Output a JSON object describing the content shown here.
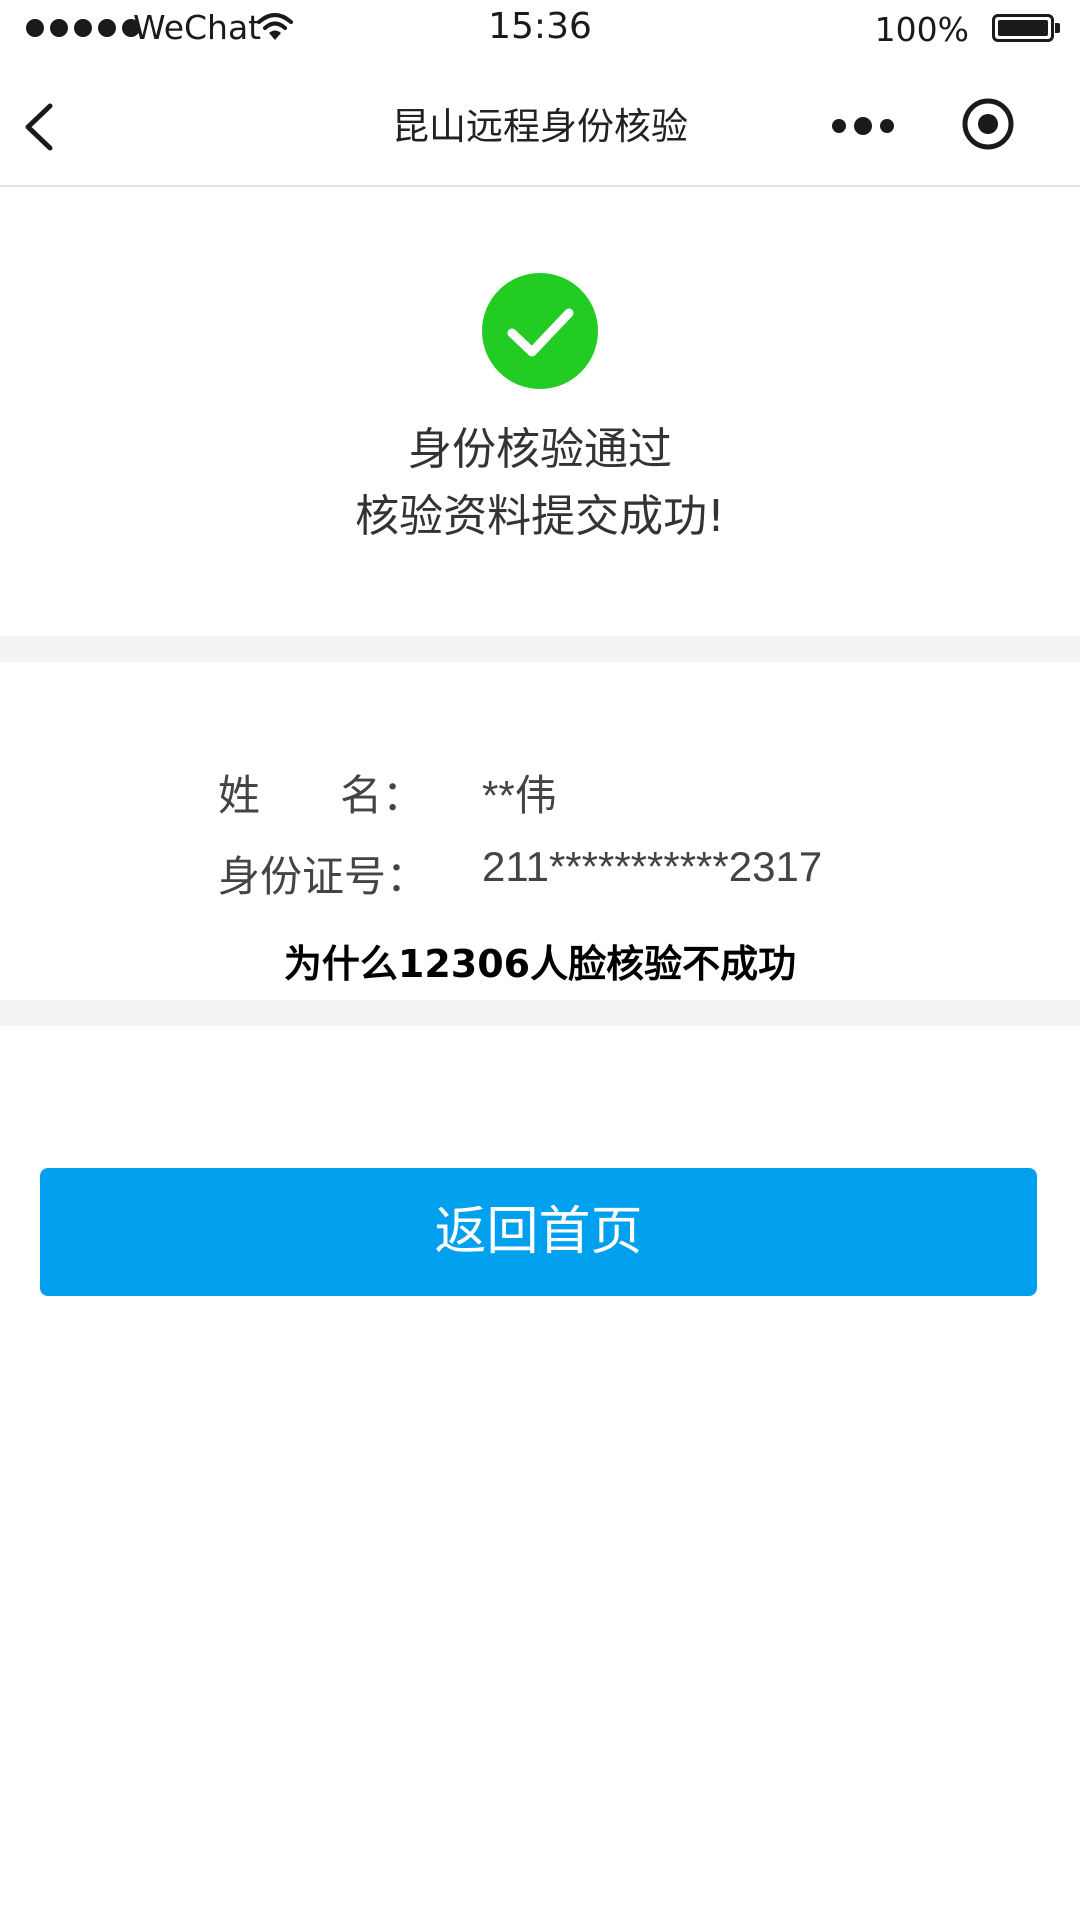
{
  "status_bar": {
    "carrier": "WeChat",
    "time": "15:36",
    "battery": "100%",
    "signal_icon": "signal-dots-icon",
    "wifi_icon": "wifi-icon",
    "battery_icon": "battery-icon"
  },
  "nav": {
    "title": "昆山远程身份核验",
    "back_icon": "chevron-left-icon",
    "more_icon": "more-dots-icon",
    "close_icon": "record-circle-icon"
  },
  "result": {
    "icon": "success-check-icon",
    "title": "身份核验通过",
    "subtitle": "核验资料提交成功!",
    "accent_color": "#22cc22"
  },
  "info": {
    "name_label": "姓      名：",
    "name_value": "**伟",
    "id_label": "身份证号：",
    "id_value": "211***********2317"
  },
  "caption": "为什么12306人脸核验不成功",
  "button": {
    "label": "返回首页",
    "color": "#00a0ee"
  }
}
